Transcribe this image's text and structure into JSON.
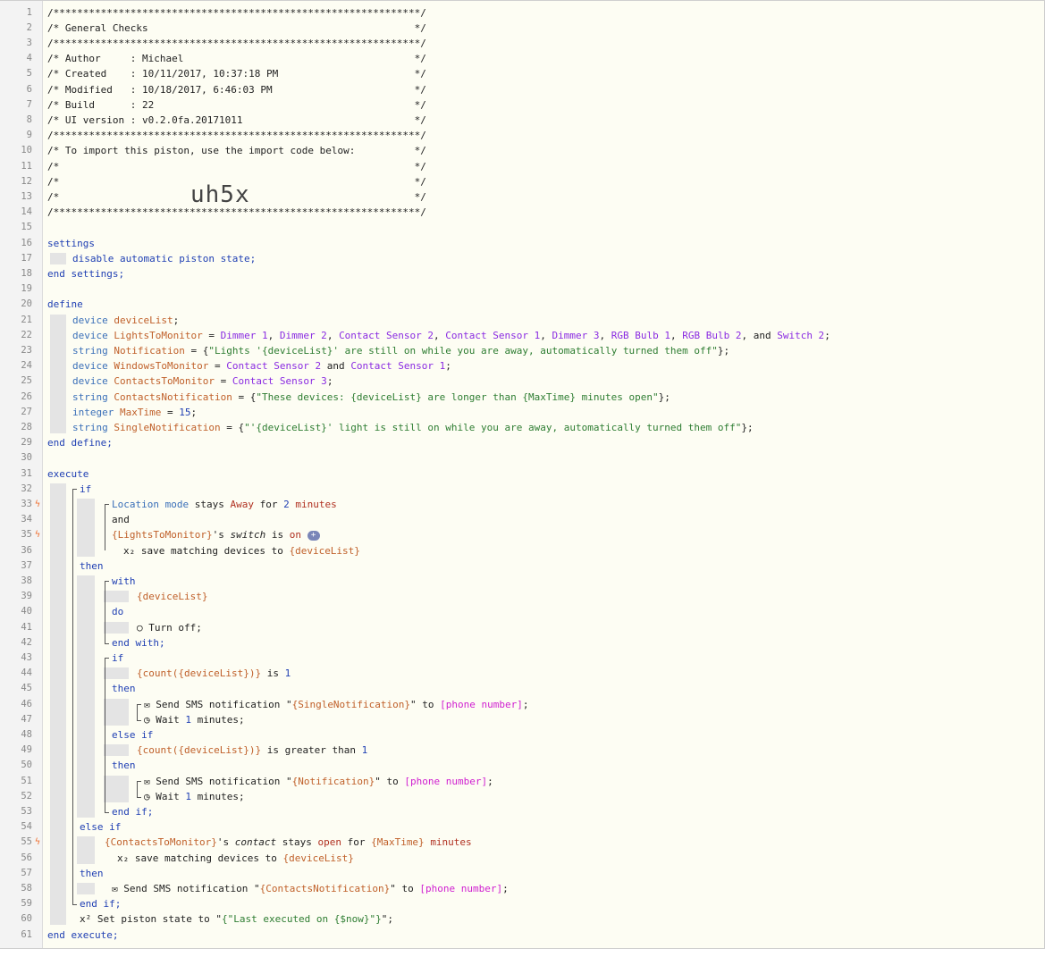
{
  "header_lines": [
    "/**************************************************************/",
    "/* General Checks                                             */",
    "/**************************************************************/",
    "/* Author     : Michael                                       */",
    "/* Created    : 10/11/2017, 10:37:18 PM                       */",
    "/* Modified   : 10/18/2017, 6:46:03 PM                        */",
    "/* Build      : 22                                            */",
    "/* UI version : v0.2.0fa.20171011                             */",
    "/**************************************************************/",
    "/* To import this piston, use the import code below:          */",
    "/*                                                            */",
    "/*                                                            */",
    "/*                                                            */",
    "/**************************************************************/"
  ],
  "import_code": "uh5x",
  "line_numbers": [
    "1",
    "2",
    "3",
    "4",
    "5",
    "6",
    "7",
    "8",
    "9",
    "10",
    "11",
    "12",
    "13",
    "14",
    "15",
    "16",
    "17",
    "18",
    "19",
    "20",
    "21",
    "22",
    "23",
    "24",
    "25",
    "26",
    "27",
    "28",
    "29",
    "30",
    "31",
    "32",
    "33",
    "34",
    "35",
    "36",
    "37",
    "38",
    "39",
    "40",
    "41",
    "42",
    "43",
    "44",
    "45",
    "46",
    "47",
    "48",
    "49",
    "50",
    "51",
    "52",
    "53",
    "54",
    "55",
    "56",
    "57",
    "58",
    "59",
    "60",
    "61"
  ],
  "trigger_lines": [
    "33",
    "35",
    "55"
  ],
  "settings": {
    "open": "settings",
    "body": "disable automatic piston state;",
    "close": "end settings;"
  },
  "define": {
    "open": "define",
    "close": "end define;",
    "kw_device": "device",
    "kw_string": "string",
    "kw_integer": "integer",
    "device_list": "deviceList",
    "lights_var": "LightsToMonitor",
    "lights_devices": [
      "Dimmer 1",
      "Dimmer 2",
      "Contact Sensor 2",
      "Contact Sensor 1",
      "Dimmer 3",
      "RGB Bulb 1",
      "RGB Bulb 2",
      "Switch 2"
    ],
    "notification_var": "Notification",
    "notification_value": "\"Lights '{deviceList}' are still on while you are away, automatically turned them off\"",
    "windows_var": "WindowsToMonitor",
    "windows_devices": [
      "Contact Sensor 2",
      "Contact Sensor 1"
    ],
    "contacts_var": "ContactsToMonitor",
    "contacts_devices": [
      "Contact Sensor 3"
    ],
    "contacts_notif_var": "ContactsNotification",
    "contacts_notif_value": "\"These devices: {deviceList} are longer than {MaxTime} minutes open\"",
    "maxtime_var": "MaxTime",
    "maxtime_value": "15",
    "single_var": "SingleNotification",
    "single_value": "\"'{deviceList}' light is still on while you are away, automatically turned them off\""
  },
  "execute": {
    "open": "execute",
    "close": "end execute;",
    "kw_if": "if",
    "kw_then": "then",
    "kw_and": "and",
    "kw_with": "with",
    "kw_do": "do",
    "kw_end_with": "end with;",
    "kw_else_if": "else if",
    "kw_end_if": "end if;",
    "location_mode": "Location mode",
    "stays": "stays",
    "away": "Away",
    "for": "for",
    "two": "2",
    "minutes": "minutes",
    "lights_ref": "{LightsToMonitor}",
    "switch_attr": "switch",
    "is": "is",
    "on": "on",
    "plus": "+",
    "x2": "x₂",
    "save_matching": "save matching devices to",
    "device_list_ref": "{deviceList}",
    "turn_off": "Turn off;",
    "count_expr": "{count({deviceList})}",
    "is_label": "is",
    "one": "1",
    "is_greater": "is greater than",
    "send_sms": "Send SMS notification",
    "single_ref": "{SingleNotification}",
    "notif_ref": "{Notification}",
    "contacts_notif_ref": "{ContactsNotification}",
    "to": "to",
    "phone": "[phone number]",
    "wait": "Wait",
    "minutes_semi": "minutes;",
    "contacts_ref": "{ContactsToMonitor}",
    "contact_attr": "contact",
    "open_word": "open",
    "maxtime_ref": "{MaxTime}",
    "xsup": "x²",
    "set_state": "Set piston state to",
    "state_value": "{\"Last executed on {$now}\"}"
  }
}
